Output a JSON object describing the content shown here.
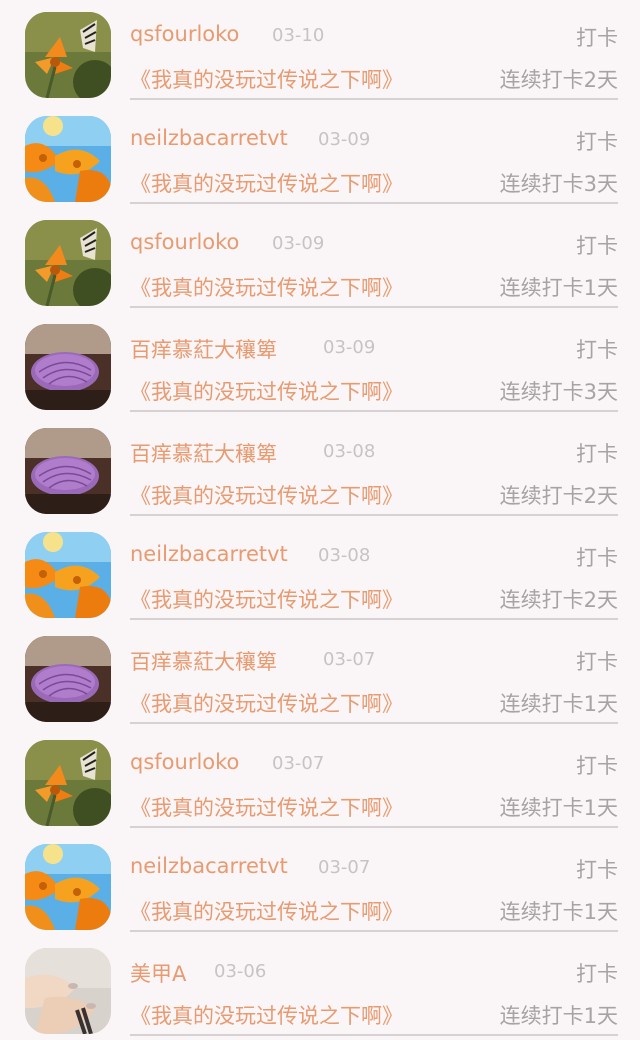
{
  "checkins": [
    {
      "user": "qsfourloko",
      "date": "03-10",
      "action": "打卡",
      "title": "《我真的没玩过传说之下啊》",
      "streak": "连续打卡2天",
      "avatar": "butterfly-flower-avatar"
    },
    {
      "user": "neilzbacarretvt",
      "date": "03-09",
      "action": "打卡",
      "title": "《我真的没玩过传说之下啊》",
      "streak": "连续打卡3天",
      "avatar": "orange-poppies-avatar"
    },
    {
      "user": "qsfourloko",
      "date": "03-09",
      "action": "打卡",
      "title": "《我真的没玩过传说之下啊》",
      "streak": "连续打卡1天",
      "avatar": "butterfly-flower-avatar"
    },
    {
      "user": "百痒慕葒大穰箄",
      "date": "03-09",
      "action": "打卡",
      "title": "《我真的没玩过传说之下啊》",
      "streak": "连续打卡3天",
      "avatar": "purple-shell-avatar"
    },
    {
      "user": "百痒慕葒大穰箄",
      "date": "03-08",
      "action": "打卡",
      "title": "《我真的没玩过传说之下啊》",
      "streak": "连续打卡2天",
      "avatar": "purple-shell-avatar"
    },
    {
      "user": "neilzbacarretvt",
      "date": "03-08",
      "action": "打卡",
      "title": "《我真的没玩过传说之下啊》",
      "streak": "连续打卡2天",
      "avatar": "orange-poppies-avatar"
    },
    {
      "user": "百痒慕葒大穰箄",
      "date": "03-07",
      "action": "打卡",
      "title": "《我真的没玩过传说之下啊》",
      "streak": "连续打卡1天",
      "avatar": "purple-shell-avatar"
    },
    {
      "user": "qsfourloko",
      "date": "03-07",
      "action": "打卡",
      "title": "《我真的没玩过传说之下啊》",
      "streak": "连续打卡1天",
      "avatar": "butterfly-flower-avatar"
    },
    {
      "user": "neilzbacarretvt",
      "date": "03-07",
      "action": "打卡",
      "title": "《我真的没玩过传说之下啊》",
      "streak": "连续打卡1天",
      "avatar": "orange-poppies-avatar"
    },
    {
      "user": "美甲A",
      "date": "03-06",
      "action": "打卡",
      "title": "《我真的没玩过传说之下啊》",
      "streak": "连续打卡1天",
      "avatar": "nail-hands-avatar"
    }
  ],
  "colors": {
    "background": "#faf6f7",
    "accent": "#e89a70",
    "muted": "#a8a2a4",
    "date": "#c9c2c4",
    "divider": "#d7d1d3"
  }
}
